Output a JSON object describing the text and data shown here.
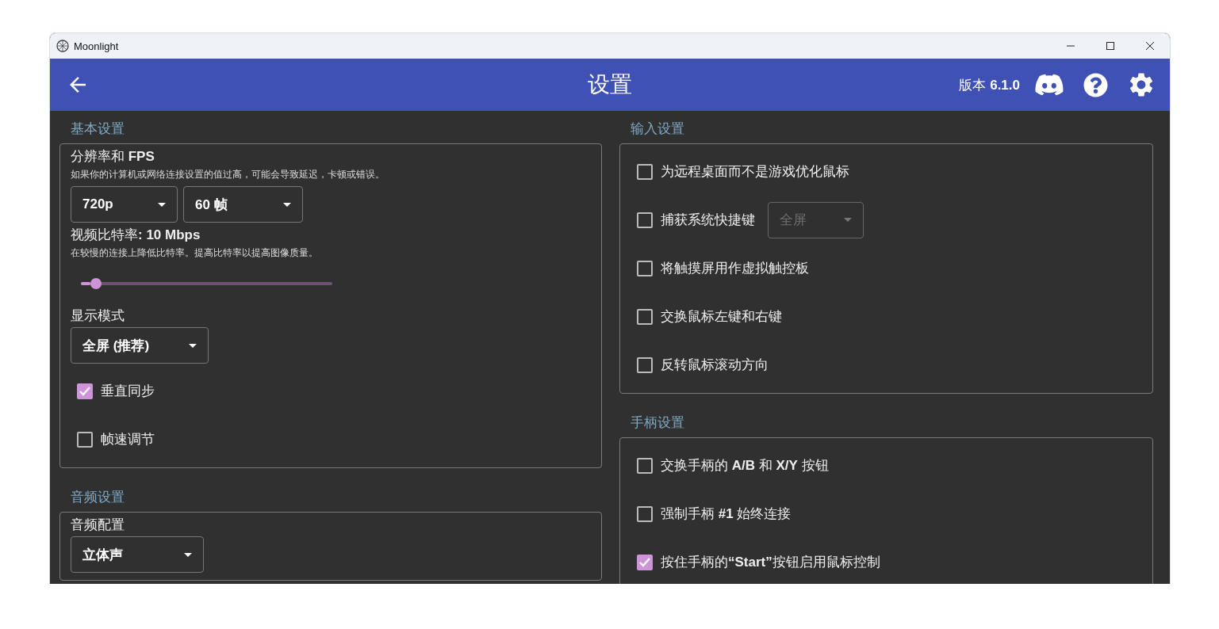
{
  "window": {
    "title": "Moonlight"
  },
  "header": {
    "title": "设置",
    "version": "版本 **6.1.0**"
  },
  "columns": [
    {
      "sections": [
        {
          "title": "基本设置",
          "items": [
            {
              "kind": "heading",
              "title": "分辨率和 **FPS**",
              "description": "如果你的计算机或网络连接设置的值过高，可能会导致延迟，卡顿或错误。"
            },
            {
              "kind": "selects",
              "selects": [
                {
                  "value": "720p",
                  "disabled": false
                },
                {
                  "value": "60 帧",
                  "disabled": false
                }
              ]
            },
            {
              "kind": "heading",
              "title": "视频比特率**: 10 Mbps**",
              "description": "在较慢的连接上降低比特率。提高比特率以提高图像质量。"
            },
            {
              "kind": "slider",
              "level": 0.06
            },
            {
              "kind": "heading",
              "title": "显示模式"
            },
            {
              "kind": "selects",
              "selects": [
                {
                  "value": "全屏 (推荐)",
                  "disabled": false
                }
              ]
            },
            {
              "kind": "checkbox",
              "label": "垂直同步",
              "checked": true
            },
            {
              "kind": "checkbox",
              "label": "帧速调节",
              "checked": false
            }
          ]
        },
        {
          "title": "音频设置",
          "items": [
            {
              "kind": "heading",
              "title": "音频配置"
            },
            {
              "kind": "selects",
              "selects": [
                {
                  "value": "立体声",
                  "disabled": false
                }
              ]
            }
          ]
        }
      ]
    },
    {
      "sections": [
        {
          "title": "输入设置",
          "items": [
            {
              "kind": "checkbox",
              "label": "为远程桌面而不是游戏优化鼠标",
              "checked": false
            },
            {
              "kind": "checkbox",
              "label": "捕获系统快捷键",
              "checked": false,
              "select": {
                "value": "全屏",
                "disabled": true
              }
            },
            {
              "kind": "checkbox",
              "label": "将触摸屏用作虚拟触控板",
              "checked": false
            },
            {
              "kind": "checkbox",
              "label": "交换鼠标左键和右键",
              "checked": false
            },
            {
              "kind": "checkbox",
              "label": "反转鼠标滚动方向",
              "checked": false
            }
          ]
        },
        {
          "title": "手柄设置",
          "items": [
            {
              "kind": "checkbox",
              "label": "交换手柄的 **A/B** 和 **X/Y** 按钮",
              "checked": false
            },
            {
              "kind": "checkbox",
              "label": "强制手柄 **#1** 始终连接",
              "checked": false
            },
            {
              "kind": "checkbox",
              "label": "按住手柄的**“Start”**按钮启用鼠标控制",
              "checked": true
            }
          ]
        }
      ]
    }
  ]
}
